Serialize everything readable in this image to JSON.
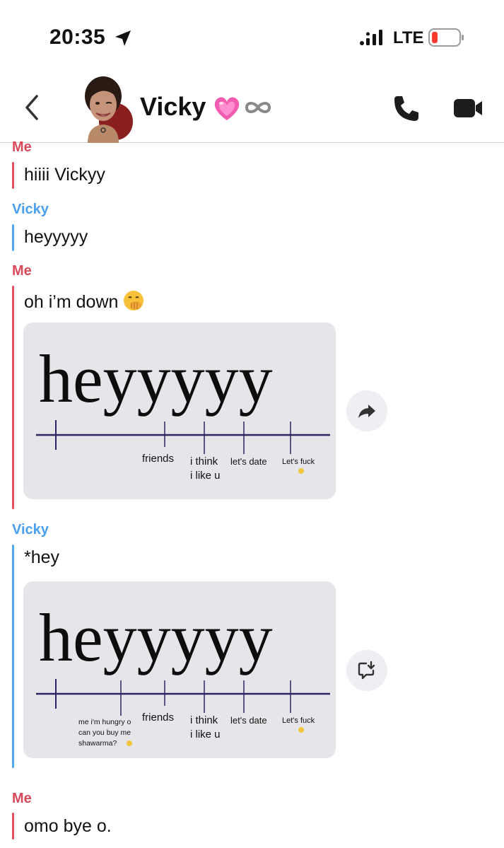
{
  "status_bar": {
    "time": "20:35",
    "network": "LTE",
    "icons": [
      "location-arrow-icon",
      "signal-icon",
      "battery-low-icon"
    ],
    "battery_color": "#ff3b30"
  },
  "header": {
    "contact_name": "Vicky",
    "icons": [
      "back-chevron-icon",
      "bitmoji-avatar",
      "pink-heart-emoji",
      "infinity-icon",
      "phone-icon",
      "video-camera-icon"
    ]
  },
  "colors": {
    "me": "#d9495a",
    "vicky": "#4a9ff0"
  },
  "messages": [
    {
      "sender": "Me",
      "text": "hiiii Vickyy"
    },
    {
      "sender": "Vicky",
      "text": "heyyyyy"
    },
    {
      "sender": "Me",
      "text": "oh i’m down",
      "emoji": "hand-over-mouth-emoji",
      "meme": {
        "word": "heyyyyy",
        "labels": [
          "friends",
          "i think",
          "i like u",
          "let's date",
          "Let's fuck"
        ]
      },
      "action": "share-arrow-icon"
    },
    {
      "sender": "Vicky",
      "text": "*hey",
      "meme": {
        "word": "heyyyyy",
        "labels": [
          "me i'm hungry o",
          "can you buy me",
          "shawarma?",
          "friends",
          "i think",
          "i like u",
          "let's date",
          "Let's fuck"
        ]
      },
      "action": "save-to-chat-icon"
    },
    {
      "sender": "Me",
      "text": "omo bye o."
    }
  ]
}
